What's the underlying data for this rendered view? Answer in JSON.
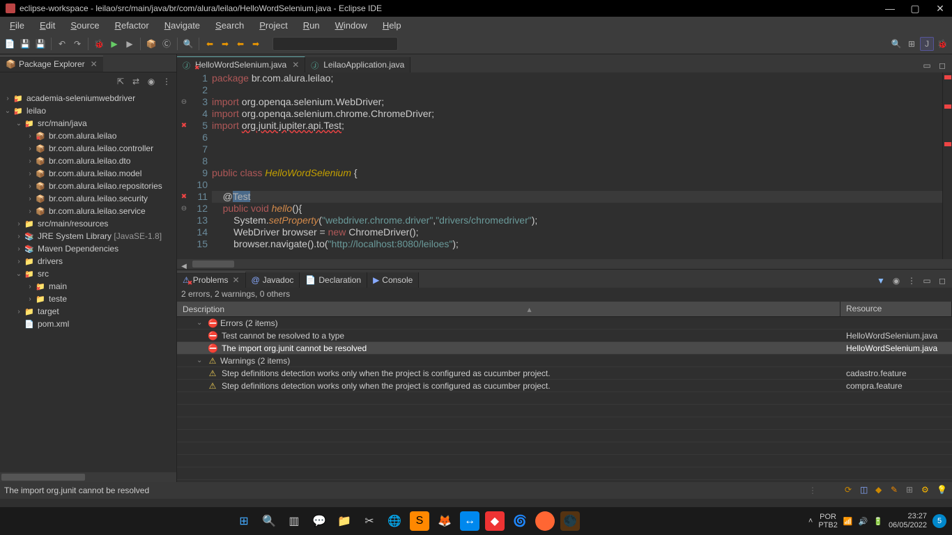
{
  "title": "eclipse-workspace - leilao/src/main/java/br/com/alura/leilao/HelloWordSelenium.java - Eclipse IDE",
  "menubar": [
    "File",
    "Edit",
    "Source",
    "Refactor",
    "Navigate",
    "Search",
    "Project",
    "Run",
    "Window",
    "Help"
  ],
  "packageExplorer": {
    "title": "Package Explorer",
    "tree": [
      {
        "t": "project",
        "l": "academia-seleniumwebdriver",
        "d": 0,
        "exp": false,
        "err": true
      },
      {
        "t": "project",
        "l": "leilao",
        "d": 0,
        "exp": true,
        "err": true
      },
      {
        "t": "srcfolder",
        "l": "src/main/java",
        "d": 1,
        "exp": true,
        "err": true
      },
      {
        "t": "package",
        "l": "br.com.alura.leilao",
        "d": 2,
        "exp": false,
        "err": true
      },
      {
        "t": "package",
        "l": "br.com.alura.leilao.controller",
        "d": 2,
        "exp": false
      },
      {
        "t": "package",
        "l": "br.com.alura.leilao.dto",
        "d": 2,
        "exp": false
      },
      {
        "t": "package",
        "l": "br.com.alura.leilao.model",
        "d": 2,
        "exp": false
      },
      {
        "t": "package",
        "l": "br.com.alura.leilao.repositories",
        "d": 2,
        "exp": false
      },
      {
        "t": "package",
        "l": "br.com.alura.leilao.security",
        "d": 2,
        "exp": false
      },
      {
        "t": "package",
        "l": "br.com.alura.leilao.service",
        "d": 2,
        "exp": false
      },
      {
        "t": "srcfolder",
        "l": "src/main/resources",
        "d": 1,
        "exp": false
      },
      {
        "t": "jre",
        "l": "JRE System Library",
        "hint": " [JavaSE-1.8]",
        "d": 1,
        "exp": false
      },
      {
        "t": "jre",
        "l": "Maven Dependencies",
        "d": 1,
        "exp": false
      },
      {
        "t": "folder",
        "l": "drivers",
        "d": 1,
        "exp": false
      },
      {
        "t": "folder",
        "l": "src",
        "d": 1,
        "exp": true,
        "err": true
      },
      {
        "t": "folder",
        "l": "main",
        "d": 2,
        "exp": false,
        "err": true
      },
      {
        "t": "folder",
        "l": "teste",
        "d": 2,
        "exp": false
      },
      {
        "t": "folder",
        "l": "target",
        "d": 1,
        "exp": false
      },
      {
        "t": "file",
        "l": "pom.xml",
        "d": 1,
        "exp": null
      }
    ]
  },
  "editor": {
    "tabs": [
      {
        "label": "HelloWordSelenium.java",
        "active": true,
        "err": true
      },
      {
        "label": "LeilaoApplication.java",
        "active": false
      }
    ],
    "lines": [
      {
        "n": 1,
        "mark": "",
        "html": "<span class='kw'>package</span> <span class='txt'>br.com.alura.leilao;</span>"
      },
      {
        "n": 2,
        "mark": "",
        "html": ""
      },
      {
        "n": 3,
        "mark": "fold",
        "html": "<span class='kw'>import</span> <span class='txt'>org.openqa.selenium.WebDriver;</span>"
      },
      {
        "n": 4,
        "mark": "",
        "html": "<span class='kw'>import</span> <span class='txt'>org.openqa.selenium.chrome.ChromeDriver;</span>"
      },
      {
        "n": 5,
        "mark": "err",
        "html": "<span class='kw'>import</span> <span class='txt underline-err'>org.junit.jupiter.api.Test</span><span class='txt'>;</span>"
      },
      {
        "n": 6,
        "mark": "",
        "html": ""
      },
      {
        "n": 7,
        "mark": "",
        "html": ""
      },
      {
        "n": 8,
        "mark": "",
        "html": ""
      },
      {
        "n": 9,
        "mark": "",
        "html": "<span class='kw'>public</span> <span class='kw'>class</span> <span class='cls'>HelloWordSelenium</span> <span class='txt'>{</span>"
      },
      {
        "n": 10,
        "mark": "",
        "html": ""
      },
      {
        "n": 11,
        "mark": "err",
        "current": true,
        "html": "    <span class='txt'>@</span><span class='ann'>Test</span>"
      },
      {
        "n": 12,
        "mark": "fold",
        "html": "    <span class='kw'>public</span> <span class='kw'>void</span> <span class='fn'>hello</span><span class='txt'>(){</span>"
      },
      {
        "n": 13,
        "mark": "",
        "html": "        <span class='txt'>System.</span><span class='fn'>setProperty</span><span class='txt'>(</span><span class='str'>\"webdriver.chrome.driver\"</span><span class='txt'>,</span><span class='str'>\"drivers/chromedriver\"</span><span class='txt'>);</span>"
      },
      {
        "n": 14,
        "mark": "",
        "html": "        <span class='txt'>WebDriver browser = </span><span class='kw'>new</span> <span class='txt'>ChromeDriver();</span>"
      },
      {
        "n": 15,
        "mark": "",
        "html": "        <span class='txt'>browser.navigate().to(</span><span class='str'>\"http://localhost:8080/leiloes\"</span><span class='txt'>);</span>"
      }
    ]
  },
  "problems": {
    "tab": "Problems",
    "otherTabs": [
      "Javadoc",
      "Declaration",
      "Console"
    ],
    "summary": "2 errors, 2 warnings, 0 others",
    "headers": {
      "desc": "Description",
      "res": "Resource"
    },
    "rows": [
      {
        "type": "group",
        "icon": "err",
        "label": "Errors (2 items)"
      },
      {
        "type": "item",
        "icon": "err",
        "label": "Test cannot be resolved to a type",
        "res": "HelloWordSelenium.java"
      },
      {
        "type": "item",
        "icon": "err",
        "label": "The import org.junit cannot be resolved",
        "res": "HelloWordSelenium.java",
        "selected": true
      },
      {
        "type": "group",
        "icon": "warn",
        "label": "Warnings (2 items)"
      },
      {
        "type": "item",
        "icon": "warn",
        "label": "Step definitions detection works only when the project is configured as cucumber project.",
        "res": "cadastro.feature"
      },
      {
        "type": "item",
        "icon": "warn",
        "label": "Step definitions detection works only when the project is configured as cucumber project.",
        "res": "compra.feature"
      }
    ]
  },
  "status": "The import org.junit cannot be resolved",
  "taskbar": {
    "lang": "POR",
    "kb": "PTB2",
    "time": "23:27",
    "date": "06/05/2022",
    "notif": "5"
  }
}
